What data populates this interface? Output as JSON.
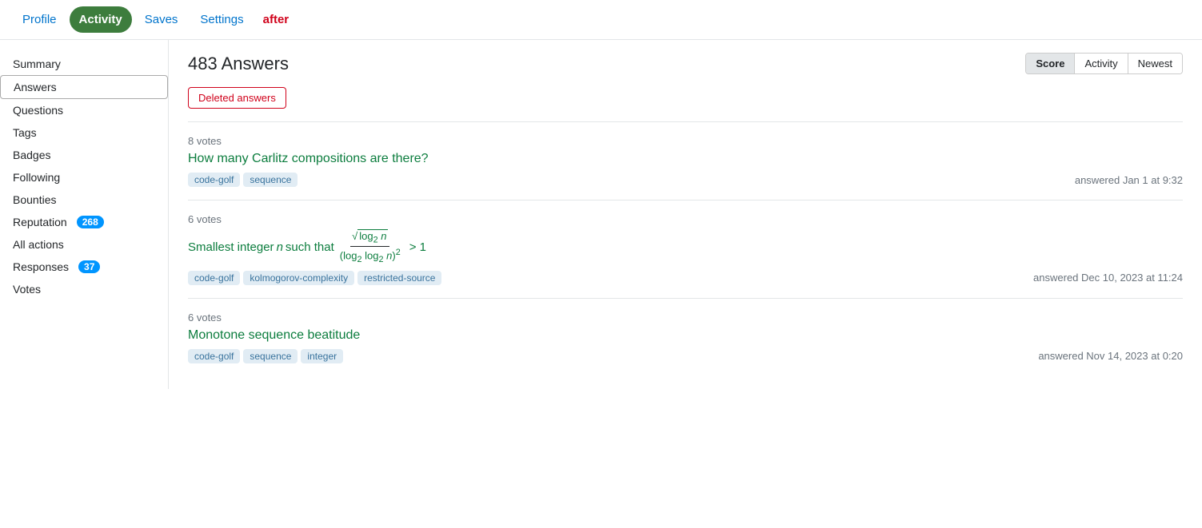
{
  "topnav": {
    "profile_label": "Profile",
    "activity_label": "Activity",
    "saves_label": "Saves",
    "settings_label": "Settings",
    "after_label": "after"
  },
  "sidebar": {
    "items": [
      {
        "id": "summary",
        "label": "Summary",
        "badge": null,
        "active": false
      },
      {
        "id": "answers",
        "label": "Answers",
        "badge": null,
        "active": true
      },
      {
        "id": "questions",
        "label": "Questions",
        "badge": null,
        "active": false
      },
      {
        "id": "tags",
        "label": "Tags",
        "badge": null,
        "active": false
      },
      {
        "id": "badges",
        "label": "Badges",
        "badge": null,
        "active": false
      },
      {
        "id": "following",
        "label": "Following",
        "badge": null,
        "active": false
      },
      {
        "id": "bounties",
        "label": "Bounties",
        "badge": null,
        "active": false
      },
      {
        "id": "reputation",
        "label": "Reputation",
        "badge": "268",
        "active": false
      },
      {
        "id": "all-actions",
        "label": "All actions",
        "badge": null,
        "active": false
      },
      {
        "id": "responses",
        "label": "Responses",
        "badge": "37",
        "active": false
      },
      {
        "id": "votes",
        "label": "Votes",
        "badge": null,
        "active": false
      }
    ]
  },
  "content": {
    "title": "483 Answers",
    "sort_buttons": [
      {
        "id": "score",
        "label": "Score",
        "active": true
      },
      {
        "id": "activity",
        "label": "Activity",
        "active": false
      },
      {
        "id": "newest",
        "label": "Newest",
        "active": false
      }
    ],
    "deleted_answers_label": "Deleted answers",
    "answers": [
      {
        "votes": "8 votes",
        "title": "How many Carlitz compositions are there?",
        "tags": [
          "code-golf",
          "sequence"
        ],
        "answered": "answered Jan 1 at 9:32"
      },
      {
        "votes": "6 votes",
        "title_prefix": "Smallest integer",
        "title_n": "n",
        "title_middle": "such that",
        "title_math": true,
        "title_suffix": "> 1",
        "tags": [
          "code-golf",
          "kolmogorov-complexity",
          "restricted-source"
        ],
        "answered": "answered Dec 10, 2023 at 11:24"
      },
      {
        "votes": "6 votes",
        "title": "Monotone sequence beatitude",
        "tags": [
          "code-golf",
          "sequence",
          "integer"
        ],
        "answered": "answered Nov 14, 2023 at 0:20"
      }
    ]
  }
}
